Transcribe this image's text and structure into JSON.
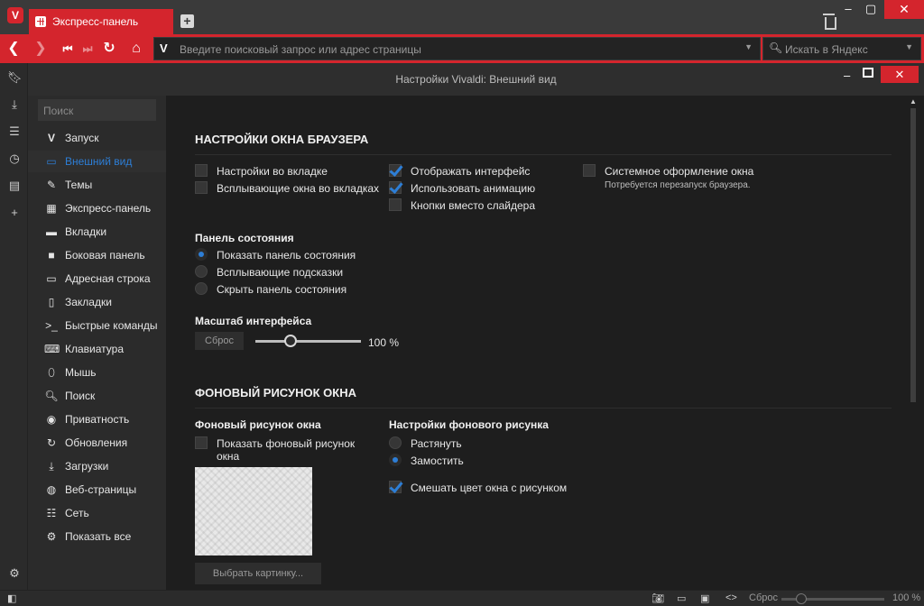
{
  "browser": {
    "tab_label": "Экспресс-панель",
    "address_placeholder": "Введите поисковый запрос или адрес страницы",
    "search_placeholder": "Искать в Яндекс",
    "accent_color": "#d4252d"
  },
  "settings_window": {
    "title": "Настройки Vivaldi: Внешний вид"
  },
  "settings_nav": {
    "filter_placeholder": "Поиск",
    "items": [
      {
        "label": "Запуск",
        "icon": "vivaldi-icon"
      },
      {
        "label": "Внешний вид",
        "icon": "window-icon",
        "active": true
      },
      {
        "label": "Темы",
        "icon": "brush-icon"
      },
      {
        "label": "Экспресс-панель",
        "icon": "grid-icon"
      },
      {
        "label": "Вкладки",
        "icon": "tabs-icon"
      },
      {
        "label": "Боковая панель",
        "icon": "side-panel-icon"
      },
      {
        "label": "Адресная строка",
        "icon": "address-bar-icon"
      },
      {
        "label": "Закладки",
        "icon": "bookmark-icon"
      },
      {
        "label": "Быстрые команды",
        "icon": "command-icon"
      },
      {
        "label": "Клавиатура",
        "icon": "keyboard-icon"
      },
      {
        "label": "Мышь",
        "icon": "mouse-icon"
      },
      {
        "label": "Поиск",
        "icon": "search-icon"
      },
      {
        "label": "Приватность",
        "icon": "eye-icon"
      },
      {
        "label": "Обновления",
        "icon": "refresh-icon"
      },
      {
        "label": "Загрузки",
        "icon": "download-icon"
      },
      {
        "label": "Веб-страницы",
        "icon": "globe-icon"
      },
      {
        "label": "Сеть",
        "icon": "network-icon"
      },
      {
        "label": "Показать все",
        "icon": "gear-icon"
      }
    ]
  },
  "window_settings": {
    "heading": "НАСТРОЙКИ ОКНА БРАУЗЕРА",
    "col1": [
      {
        "label": "Настройки во вкладке",
        "checked": false
      },
      {
        "label": "Всплывающие окна во вкладках",
        "checked": false
      }
    ],
    "col2": [
      {
        "label": "Отображать интерфейс",
        "checked": true
      },
      {
        "label": "Использовать анимацию",
        "checked": true
      },
      {
        "label": "Кнопки вместо слайдера",
        "checked": false
      }
    ],
    "col3": {
      "label": "Системное оформление окна",
      "checked": false,
      "note": "Потребуется перезапуск браузера."
    },
    "status_panel": {
      "heading": "Панель состояния",
      "options": [
        {
          "label": "Показать панель состояния",
          "selected": true
        },
        {
          "label": "Всплывающие подсказки",
          "selected": false
        },
        {
          "label": "Скрыть панель состояния",
          "selected": false
        }
      ]
    },
    "scale": {
      "heading": "Масштаб интерфейса",
      "reset_label": "Сброс",
      "value_label": "100 %",
      "value_fraction": 0.33
    }
  },
  "background": {
    "heading": "ФОНОВЫЙ РИСУНОК ОКНА",
    "left_heading": "Фоновый рисунок окна",
    "show_label_line1": "Показать фоновый рисунок",
    "show_label_line2": "окна",
    "show_checked": false,
    "choose_button": "Выбрать картинку...",
    "right_heading": "Настройки фонового рисунка",
    "options": [
      {
        "label": "Растянуть",
        "selected": false
      },
      {
        "label": "Замостить",
        "selected": true
      }
    ],
    "blend_label": "Смешать цвет окна с рисунком",
    "blend_checked": true
  },
  "statusbar": {
    "zoom_label": "Сброс",
    "zoom_value": "100 %"
  }
}
